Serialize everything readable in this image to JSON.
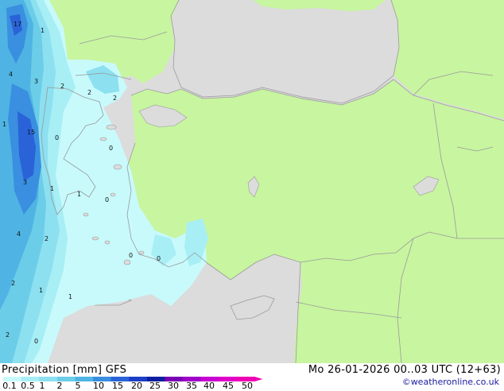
{
  "header": {
    "title": "Precipitation [mm] GFS",
    "valid_time": "Mo 26-01-2026 00..03 UTC (12+63)",
    "credit": "©weatheronline.co.uk"
  },
  "legend": {
    "ticks": [
      "0.1",
      "0.5",
      "1",
      "2",
      "5",
      "10",
      "15",
      "20",
      "25",
      "30",
      "35",
      "40",
      "45",
      "50"
    ],
    "colors": [
      "#c8fafc",
      "#a8eef5",
      "#8ce0f0",
      "#6ccde8",
      "#4fb4e3",
      "#3a8fe0",
      "#2a63d8",
      "#1c3fc6",
      "#0d1fa0",
      "#7a00b4",
      "#a000c8",
      "#c800d2",
      "#e000c8",
      "#f000b4"
    ]
  },
  "map_colors": {
    "sea": "#dcdcdc",
    "land": "#c8f5a0",
    "border": "#9a9a9a"
  },
  "map_labels": [
    "17",
    "1",
    "4",
    "3",
    "2",
    "2",
    "2",
    "15",
    "1",
    "0",
    "0",
    "3",
    "1",
    "1",
    "0",
    "4",
    "2",
    "0",
    "0",
    "2",
    "1",
    "1",
    "2",
    "0"
  ]
}
